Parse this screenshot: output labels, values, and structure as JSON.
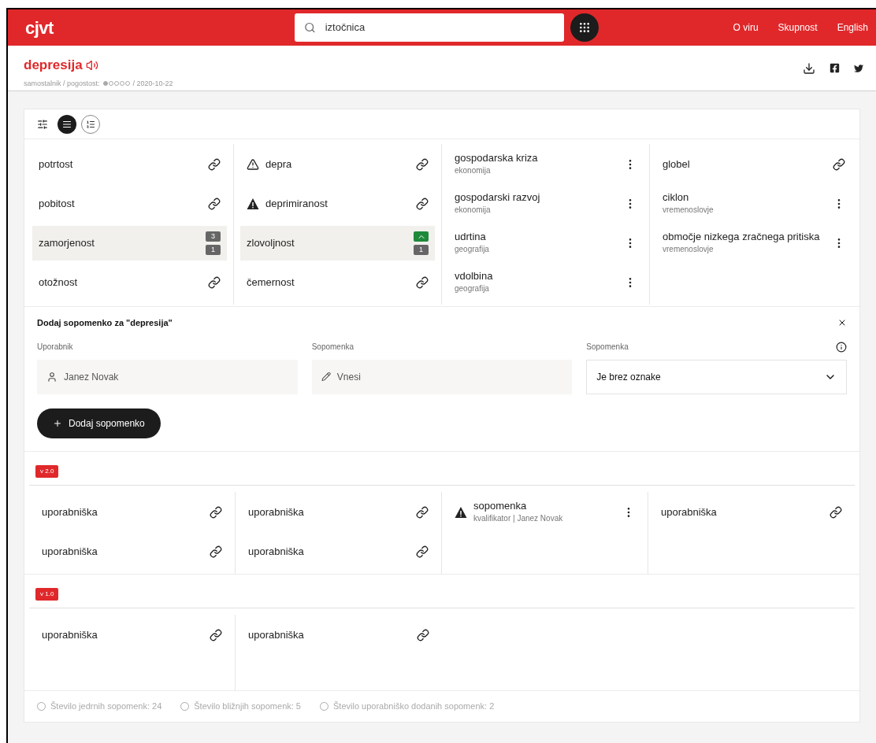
{
  "header": {
    "logo": "cjvt",
    "search": {
      "value": "iztočnica"
    },
    "nav": [
      "O viru",
      "Skupnost",
      "English"
    ]
  },
  "entry": {
    "headword": "depresija",
    "meta_before": "samostalnik / pogostost:",
    "frequency": {
      "stars": 1
    },
    "meta_after": "/ 2020-10-22"
  },
  "view_modes": [
    {
      "kind": "list",
      "selected": true
    },
    {
      "kind": "grouped",
      "selected": false
    }
  ],
  "synonym_columns": [
    [
      {
        "word": "potrtost",
        "kind": "link",
        "highlighted": false
      },
      {
        "word": "pobitost",
        "kind": "link",
        "highlighted": false
      },
      {
        "word": "zamorjenost",
        "kind": "counts",
        "highlighted": true,
        "badges": [
          {
            "kind": "count",
            "text": "3"
          },
          {
            "kind": "count",
            "text": "1"
          }
        ]
      },
      {
        "word": "otožnost",
        "kind": "link",
        "highlighted": false
      }
    ],
    [
      {
        "word": "depra",
        "kind": "link",
        "warning": {
          "kind": "outline"
        },
        "highlighted": false
      },
      {
        "word": "deprimiranost",
        "kind": "link",
        "warning": {
          "kind": "filled"
        },
        "highlighted": false
      },
      {
        "word": "zlovoljnost",
        "kind": "counts",
        "highlighted": true,
        "badges": [
          {
            "kind": "vote"
          },
          {
            "kind": "count",
            "text": "1"
          }
        ]
      },
      {
        "word": "čemernost",
        "kind": "link",
        "highlighted": false
      }
    ],
    [
      {
        "word": "gospodarska kriza",
        "domain": "ekonomija",
        "kind": "menu",
        "highlighted": false
      },
      {
        "word": "gospodarski razvoj",
        "domain": "ekonomija",
        "kind": "menu",
        "highlighted": false
      },
      {
        "word": "udrtina",
        "domain": "geografija",
        "kind": "menu",
        "highlighted": false
      },
      {
        "word": "vdolbina",
        "domain": "geografija",
        "kind": "menu",
        "highlighted": false
      }
    ],
    [
      {
        "word": "globel",
        "kind": "link",
        "highlighted": false
      },
      {
        "word": "ciklon",
        "domain": "vremenoslovje",
        "kind": "menu",
        "highlighted": false
      },
      {
        "word": "območje nizkega zračnega pritiska",
        "domain": "vremenoslovje",
        "kind": "menu",
        "highlighted": false
      }
    ]
  ],
  "add_form": {
    "title": "Dodaj sopomenko za \"depresija\"",
    "fields": [
      {
        "kind": "user",
        "label": "Uporabnik",
        "value": "Janez Novak"
      },
      {
        "kind": "edit",
        "label": "Sopomenka",
        "placeholder": "Vnesi"
      },
      {
        "kind": "select",
        "label": "Sopomenka",
        "value": "Je brez oznake"
      }
    ],
    "button": "Dodaj sopomenko"
  },
  "versions": [
    {
      "label": "v 2.0",
      "columns": [
        [
          {
            "word": "uporabniška",
            "kind": "link",
            "highlighted": false
          },
          {
            "word": "uporabniška",
            "kind": "link",
            "highlighted": false
          }
        ],
        [
          {
            "word": "uporabniška",
            "kind": "link",
            "highlighted": false
          },
          {
            "word": "uporabniška",
            "kind": "link",
            "highlighted": false
          }
        ],
        [
          {
            "word": "sopomenka",
            "domain": "kvalifikator | Janez Novak",
            "kind": "menu",
            "warning": {
              "kind": "filled"
            },
            "highlighted": false
          }
        ],
        [
          {
            "word": "uporabniška",
            "kind": "link",
            "highlighted": false
          }
        ]
      ]
    },
    {
      "label": "v 1.0",
      "columns": [
        [
          {
            "word": "uporabniška",
            "kind": "link",
            "highlighted": false
          }
        ],
        [
          {
            "word": "uporabniška",
            "kind": "link",
            "highlighted": false
          }
        ]
      ]
    }
  ],
  "stats": [
    {
      "text": "Število jedrnih sopomenk: 24",
      "selected": false
    },
    {
      "text": "Število bližnjih sopomenk: 5",
      "selected": false
    },
    {
      "text": "Število uporabniško dodanih sopomenk: 2",
      "selected": false
    }
  ]
}
